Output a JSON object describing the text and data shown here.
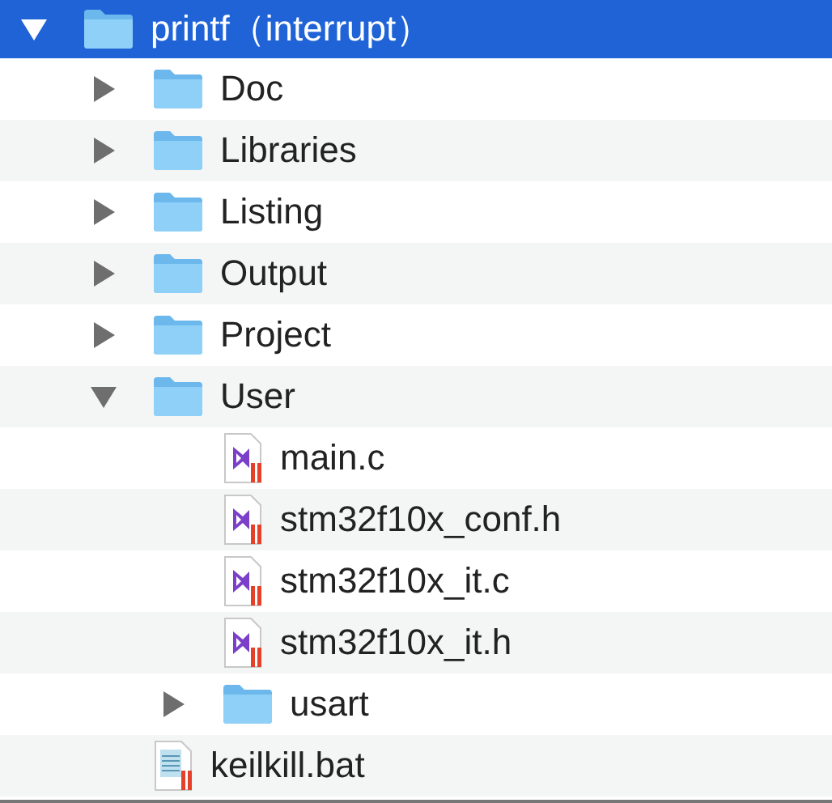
{
  "tree": [
    {
      "name": "printf（interrupt）",
      "kind": "folder",
      "expanded": true,
      "selected": true,
      "children": [
        {
          "name": "Doc",
          "kind": "folder",
          "expanded": false,
          "selected": false
        },
        {
          "name": "Libraries",
          "kind": "folder",
          "expanded": false,
          "selected": false
        },
        {
          "name": "Listing",
          "kind": "folder",
          "expanded": false,
          "selected": false
        },
        {
          "name": "Output",
          "kind": "folder",
          "expanded": false,
          "selected": false
        },
        {
          "name": "Project",
          "kind": "folder",
          "expanded": false,
          "selected": false
        },
        {
          "name": "User",
          "kind": "folder",
          "expanded": true,
          "selected": false,
          "children": [
            {
              "name": "main.c",
              "kind": "source",
              "selected": false
            },
            {
              "name": "stm32f10x_conf.h",
              "kind": "source",
              "selected": false
            },
            {
              "name": "stm32f10x_it.c",
              "kind": "source",
              "selected": false
            },
            {
              "name": "stm32f10x_it.h",
              "kind": "source",
              "selected": false
            },
            {
              "name": "usart",
              "kind": "folder",
              "expanded": false,
              "selected": false
            }
          ]
        },
        {
          "name": "keilkill.bat",
          "kind": "script",
          "selected": false
        }
      ]
    }
  ]
}
